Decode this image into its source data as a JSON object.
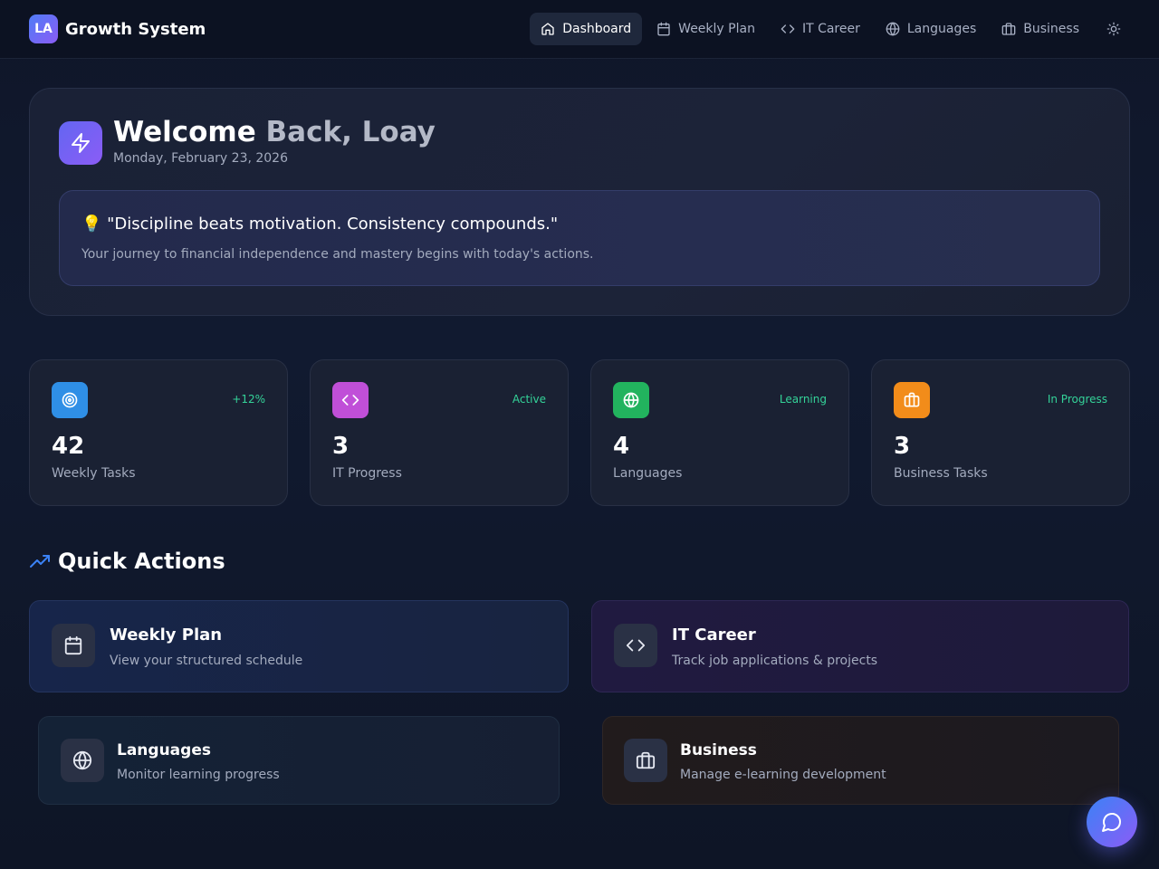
{
  "brand": {
    "logo_text": "LA",
    "name": "Growth System"
  },
  "nav": {
    "items": [
      {
        "label": "Dashboard",
        "icon": "home-icon",
        "active": true
      },
      {
        "label": "Weekly Plan",
        "icon": "calendar-icon"
      },
      {
        "label": "IT Career",
        "icon": "code-icon"
      },
      {
        "label": "Languages",
        "icon": "globe-icon"
      },
      {
        "label": "Business",
        "icon": "briefcase-icon"
      }
    ],
    "theme_icon": "sun-icon"
  },
  "hero": {
    "title_start": "Welcome ",
    "title_fade": "Back, Loay",
    "date": "Monday, February 23, 2026",
    "quote": "💡 \"Discipline beats motivation. Consistency compounds.\"",
    "quote_sub": "Your journey to financial independence and mastery begins with today's actions."
  },
  "stats": [
    {
      "value": "42",
      "label": "Weekly Tasks",
      "badge": "+12%",
      "icon": "target-icon",
      "color": "#2f8fe6"
    },
    {
      "value": "3",
      "label": "IT Progress",
      "badge": "Active",
      "icon": "code-icon",
      "color": "#c04fd8"
    },
    {
      "value": "4",
      "label": "Languages",
      "badge": "Learning",
      "icon": "globe-icon",
      "color": "#22b35e"
    },
    {
      "value": "3",
      "label": "Business Tasks",
      "badge": "In Progress",
      "icon": "briefcase-icon",
      "color": "#f28c1a"
    }
  ],
  "quick_actions": {
    "title": "Quick Actions",
    "items": [
      {
        "title": "Weekly Plan",
        "sub": "View your structured schedule",
        "icon": "calendar-icon"
      },
      {
        "title": "IT Career",
        "sub": "Track job applications & projects",
        "icon": "code-icon"
      },
      {
        "title": "Languages",
        "sub": "Monitor learning progress",
        "icon": "globe-icon"
      },
      {
        "title": "Business",
        "sub": "Manage e-learning development",
        "icon": "briefcase-icon"
      }
    ]
  },
  "colors": {
    "accent": "#6366f1",
    "positive": "#34d399",
    "background": "#0f1629"
  }
}
